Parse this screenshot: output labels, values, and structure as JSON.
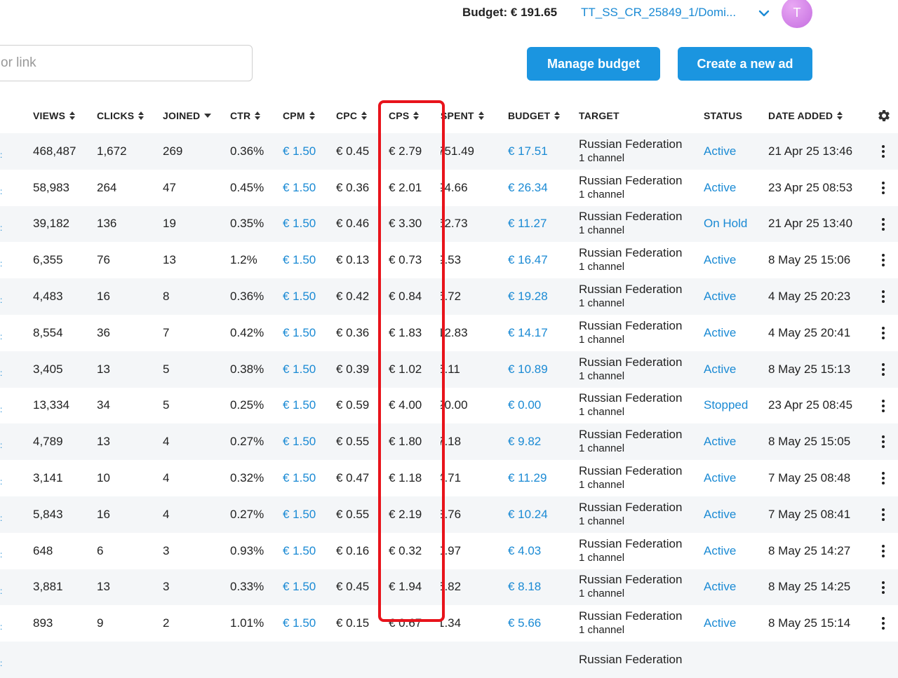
{
  "header": {
    "budget_label": "Budget: € 191.65",
    "account_name": "TT_SS_CR_25849_1/Domi...",
    "avatar_initial": "T"
  },
  "search": {
    "placeholder": "or link"
  },
  "actions": {
    "manage_budget": "Manage budget",
    "create_ad": "Create a new ad"
  },
  "table": {
    "columns": [
      "VIEWS",
      "CLICKS",
      "JOINED",
      "CTR",
      "CPM",
      "CPC",
      "CPS",
      "SPENT",
      "BUDGET",
      "TARGET",
      "STATUS",
      "DATE ADDED"
    ],
    "rows": [
      {
        "views": "468,487",
        "clicks": "1,672",
        "joined": "269",
        "ctr": "0.36%",
        "cpm": "€ 1.50",
        "cpc": "€ 0.45",
        "cps": "€ 2.79",
        "spent": "751.49",
        "budget": "€ 17.51",
        "target": "Russian Federation",
        "target_sub": "1 channel",
        "status": "Active",
        "date": "21 Apr 25 13:46"
      },
      {
        "views": "58,983",
        "clicks": "264",
        "joined": "47",
        "ctr": "0.45%",
        "cpm": "€ 1.50",
        "cpc": "€ 0.36",
        "cps": "€ 2.01",
        "spent": "94.66",
        "budget": "€ 26.34",
        "target": "Russian Federation",
        "target_sub": "1 channel",
        "status": "Active",
        "date": "23 Apr 25 08:53"
      },
      {
        "views": "39,182",
        "clicks": "136",
        "joined": "19",
        "ctr": "0.35%",
        "cpm": "€ 1.50",
        "cpc": "€ 0.46",
        "cps": "€ 3.30",
        "spent": "62.73",
        "budget": "€ 11.27",
        "target": "Russian Federation",
        "target_sub": "1 channel",
        "status": "On Hold",
        "date": "21 Apr 25 13:40"
      },
      {
        "views": "6,355",
        "clicks": "76",
        "joined": "13",
        "ctr": "1.2%",
        "cpm": "€ 1.50",
        "cpc": "€ 0.13",
        "cps": "€ 0.73",
        "spent": "9.53",
        "budget": "€ 16.47",
        "target": "Russian Federation",
        "target_sub": "1 channel",
        "status": "Active",
        "date": "8 May 25 15:06"
      },
      {
        "views": "4,483",
        "clicks": "16",
        "joined": "8",
        "ctr": "0.36%",
        "cpm": "€ 1.50",
        "cpc": "€ 0.42",
        "cps": "€ 0.84",
        "spent": "6.72",
        "budget": "€ 19.28",
        "target": "Russian Federation",
        "target_sub": "1 channel",
        "status": "Active",
        "date": "4 May 25 20:23"
      },
      {
        "views": "8,554",
        "clicks": "36",
        "joined": "7",
        "ctr": "0.42%",
        "cpm": "€ 1.50",
        "cpc": "€ 0.36",
        "cps": "€ 1.83",
        "spent": "12.83",
        "budget": "€ 14.17",
        "target": "Russian Federation",
        "target_sub": "1 channel",
        "status": "Active",
        "date": "4 May 25 20:41"
      },
      {
        "views": "3,405",
        "clicks": "13",
        "joined": "5",
        "ctr": "0.38%",
        "cpm": "€ 1.50",
        "cpc": "€ 0.39",
        "cps": "€ 1.02",
        "spent": "5.11",
        "budget": "€ 10.89",
        "target": "Russian Federation",
        "target_sub": "1 channel",
        "status": "Active",
        "date": "8 May 25 15:13"
      },
      {
        "views": "13,334",
        "clicks": "34",
        "joined": "5",
        "ctr": "0.25%",
        "cpm": "€ 1.50",
        "cpc": "€ 0.59",
        "cps": "€ 4.00",
        "spent": "20.00",
        "budget": "€ 0.00",
        "target": "Russian Federation",
        "target_sub": "1 channel",
        "status": "Stopped",
        "date": "23 Apr 25 08:45"
      },
      {
        "views": "4,789",
        "clicks": "13",
        "joined": "4",
        "ctr": "0.27%",
        "cpm": "€ 1.50",
        "cpc": "€ 0.55",
        "cps": "€ 1.80",
        "spent": "7.18",
        "budget": "€ 9.82",
        "target": "Russian Federation",
        "target_sub": "1 channel",
        "status": "Active",
        "date": "8 May 25 15:05"
      },
      {
        "views": "3,141",
        "clicks": "10",
        "joined": "4",
        "ctr": "0.32%",
        "cpm": "€ 1.50",
        "cpc": "€ 0.47",
        "cps": "€ 1.18",
        "spent": "4.71",
        "budget": "€ 11.29",
        "target": "Russian Federation",
        "target_sub": "1 channel",
        "status": "Active",
        "date": "7 May 25 08:48"
      },
      {
        "views": "5,843",
        "clicks": "16",
        "joined": "4",
        "ctr": "0.27%",
        "cpm": "€ 1.50",
        "cpc": "€ 0.55",
        "cps": "€ 2.19",
        "spent": "8.76",
        "budget": "€ 10.24",
        "target": "Russian Federation",
        "target_sub": "1 channel",
        "status": "Active",
        "date": "7 May 25 08:41"
      },
      {
        "views": "648",
        "clicks": "6",
        "joined": "3",
        "ctr": "0.93%",
        "cpm": "€ 1.50",
        "cpc": "€ 0.16",
        "cps": "€ 0.32",
        "spent": "0.97",
        "budget": "€ 4.03",
        "target": "Russian Federation",
        "target_sub": "1 channel",
        "status": "Active",
        "date": "8 May 25 14:27"
      },
      {
        "views": "3,881",
        "clicks": "13",
        "joined": "3",
        "ctr": "0.33%",
        "cpm": "€ 1.50",
        "cpc": "€ 0.45",
        "cps": "€ 1.94",
        "spent": "5.82",
        "budget": "€ 8.18",
        "target": "Russian Federation",
        "target_sub": "1 channel",
        "status": "Active",
        "date": "8 May 25 14:25"
      },
      {
        "views": "893",
        "clicks": "9",
        "joined": "2",
        "ctr": "1.01%",
        "cpm": "€ 1.50",
        "cpc": "€ 0.15",
        "cps": "€ 0.67",
        "spent": "1.34",
        "budget": "€ 5.66",
        "target": "Russian Federation",
        "target_sub": "1 channel",
        "status": "Active",
        "date": "8 May 25 15:14"
      },
      {
        "views": "",
        "clicks": "",
        "joined": "",
        "ctr": "",
        "cpm": "",
        "cpc": "",
        "cps": "",
        "spent": "",
        "budget": "",
        "target": "Russian Federation",
        "target_sub": "",
        "status": "",
        "date": ""
      }
    ]
  },
  "colors": {
    "accent": "#1b95e0",
    "link": "#1a8ad4",
    "highlight": "#e8131b",
    "row_alt": "#f4f6f8"
  }
}
